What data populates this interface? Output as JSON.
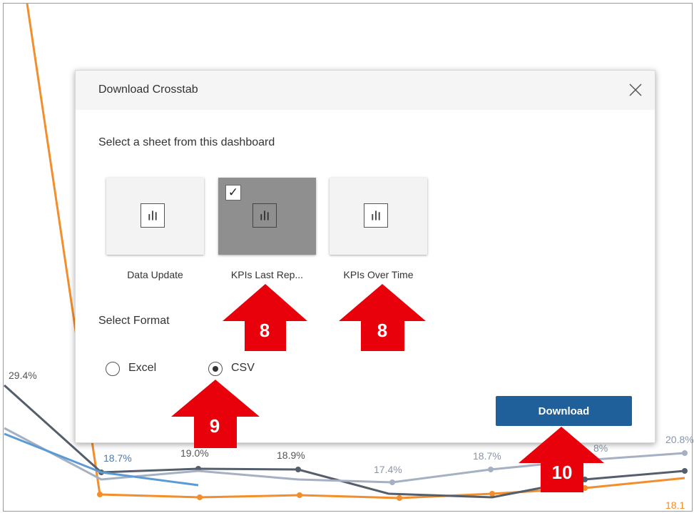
{
  "chart_data": {
    "type": "line",
    "series": [
      {
        "color": "#f28e2b",
        "values": [
          18.1
        ]
      },
      {
        "color": "#4e79a7",
        "values": [
          18.7
        ]
      },
      {
        "color": "#555f6b",
        "values": [
          19.0,
          18.9
        ]
      },
      {
        "color": "#a5b0c3",
        "values": [
          17.4,
          18.7,
          20.8
        ]
      }
    ],
    "labels": [
      {
        "text": "29.4%",
        "color": "#555555"
      },
      {
        "text": "18.7%",
        "color": "#4e79a7"
      },
      {
        "text": "19.0%",
        "color": "#555555"
      },
      {
        "text": "18.9%",
        "color": "#555555"
      },
      {
        "text": "17.4%",
        "color": "#8a95a8"
      },
      {
        "text": "18.7%",
        "color": "#8a95a8"
      },
      {
        "text": "8%",
        "color": "#8a95a8"
      },
      {
        "text": "20.8%",
        "color": "#8a95a8"
      },
      {
        "text": "18.1",
        "color": "#f28e2b"
      }
    ]
  },
  "dialog": {
    "title": "Download Crosstab",
    "close_icon": "close-icon",
    "sheet_prompt": "Select a sheet from this dashboard",
    "sheets": [
      {
        "label": "Data Update",
        "selected": false,
        "icon": "bar-chart-icon"
      },
      {
        "label": "KPIs Last Rep...",
        "selected": true,
        "icon": "bar-chart-icon",
        "check": "✓"
      },
      {
        "label": "KPIs Over Time",
        "selected": false,
        "icon": "bar-chart-icon"
      }
    ],
    "format_label": "Select Format",
    "formats": [
      {
        "label": "Excel",
        "selected": false
      },
      {
        "label": "CSV",
        "selected": true
      }
    ],
    "download_label": "Download",
    "accent_color": "#1f5f9a"
  },
  "annotations": {
    "color": "#e8000b",
    "markers": [
      "8",
      "8",
      "9",
      "10"
    ]
  }
}
